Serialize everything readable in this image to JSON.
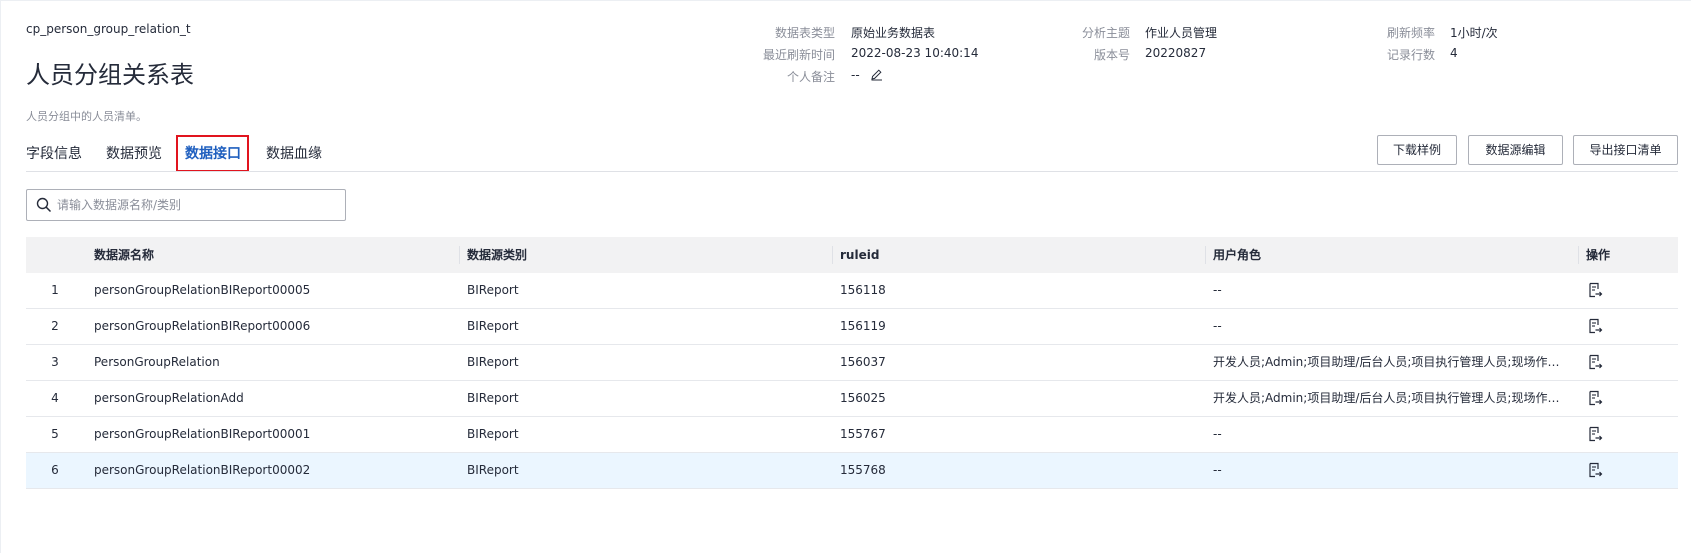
{
  "header": {
    "table_code": "cp_person_group_relation_t",
    "title": "人员分组关系表",
    "description": "人员分组中的人员清单。"
  },
  "meta": {
    "type_label": "数据表类型",
    "type_value": "原始业务数据表",
    "topic_label": "分析主题",
    "topic_value": "作业人员管理",
    "freq_label": "刷新频率",
    "freq_value": "1小时/次",
    "refresh_label": "最近刷新时间",
    "refresh_value": "2022-08-23 10:40:14",
    "version_label": "版本号",
    "version_value": "20220827",
    "rows_label": "记录行数",
    "rows_value": "4",
    "note_label": "个人备注",
    "note_value": "--"
  },
  "tabs": [
    {
      "label": "字段信息",
      "active": false
    },
    {
      "label": "数据预览",
      "active": false
    },
    {
      "label": "数据接口",
      "active": true
    },
    {
      "label": "数据血缘",
      "active": false
    }
  ],
  "buttons": {
    "download_sample": "下载样例",
    "edit_datasource": "数据源编辑",
    "export_interface": "导出接口清单"
  },
  "search": {
    "placeholder": "请输入数据源名称/类别",
    "value": ""
  },
  "table": {
    "columns": [
      "数据源名称",
      "数据源类别",
      "ruleid",
      "用户角色",
      "操作"
    ],
    "rows": [
      {
        "index": "1",
        "name": "personGroupRelationBIReport00005",
        "category": "BIReport",
        "ruleid": "156118",
        "roles": "--",
        "selected": false
      },
      {
        "index": "2",
        "name": "personGroupRelationBIReport00006",
        "category": "BIReport",
        "ruleid": "156119",
        "roles": "--",
        "selected": false
      },
      {
        "index": "3",
        "name": "PersonGroupRelation",
        "category": "BIReport",
        "ruleid": "156037",
        "roles": "开发人员;Admin;项目助理/后台人员;项目执行管理人员;现场作业...",
        "selected": false
      },
      {
        "index": "4",
        "name": "personGroupRelationAdd",
        "category": "BIReport",
        "ruleid": "156025",
        "roles": "开发人员;Admin;项目助理/后台人员;项目执行管理人员;现场作业...",
        "selected": false
      },
      {
        "index": "5",
        "name": "personGroupRelationBIReport00001",
        "category": "BIReport",
        "ruleid": "155767",
        "roles": "--",
        "selected": false
      },
      {
        "index": "6",
        "name": "personGroupRelationBIReport00002",
        "category": "BIReport",
        "ruleid": "155768",
        "roles": "--",
        "selected": true
      }
    ]
  },
  "colors": {
    "accent": "#1f5fbf",
    "highlight_box": "#e1141e",
    "selected_row": "#ebf6ff",
    "header_bg": "#f2f2f3"
  },
  "icons": {
    "search": "search-icon",
    "edit_note": "pencil-icon",
    "row_action": "document-export-icon"
  }
}
